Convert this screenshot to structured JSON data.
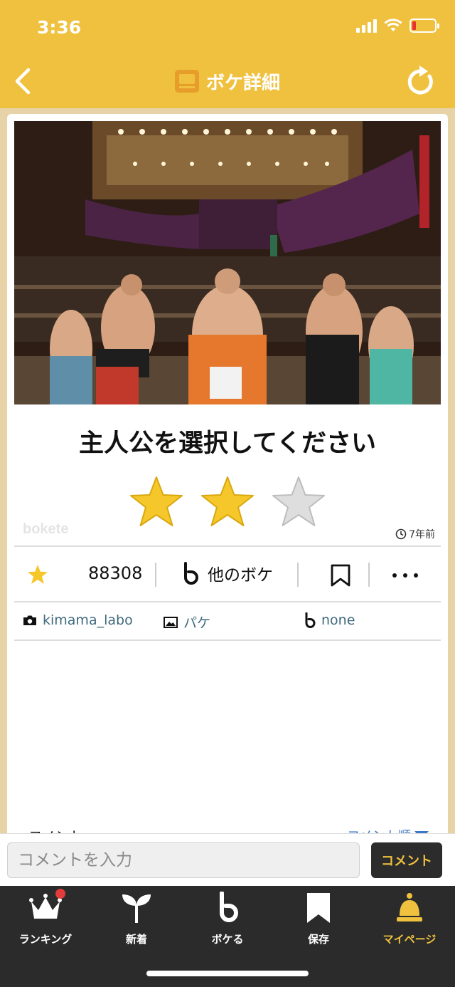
{
  "status": {
    "time": "3:36"
  },
  "nav": {
    "title": "ボケ詳細"
  },
  "post": {
    "caption": "主人公を選択してください",
    "watermark": "bokete",
    "age": "7年前",
    "star_rating": {
      "filled": 2,
      "total": 3
    },
    "score": "88308",
    "other_bokes_label": "他のボケ",
    "photographer": "kimama_labo",
    "template_label": "パケ",
    "bokete_author": "none"
  },
  "comments": {
    "header_label": "コメント",
    "sort_label": "コメント順"
  },
  "comment_bar": {
    "placeholder": "コメントを入力",
    "submit_label": "コメント"
  },
  "tabs": [
    {
      "label": "ランキング",
      "icon": "crown-icon"
    },
    {
      "label": "新着",
      "icon": "sprout-icon"
    },
    {
      "label": "ボケる",
      "icon": "bokete-b-icon"
    },
    {
      "label": "保存",
      "icon": "bookmark-icon"
    },
    {
      "label": "マイページ",
      "icon": "bell-icon"
    }
  ],
  "colors": {
    "header": "#efc13e",
    "star_filled": "#f5c72b",
    "star_empty": "#d9d9d9",
    "tab_bar": "#2b2b2b",
    "active_tab": "#efc13e",
    "link": "#3f6a7e"
  }
}
